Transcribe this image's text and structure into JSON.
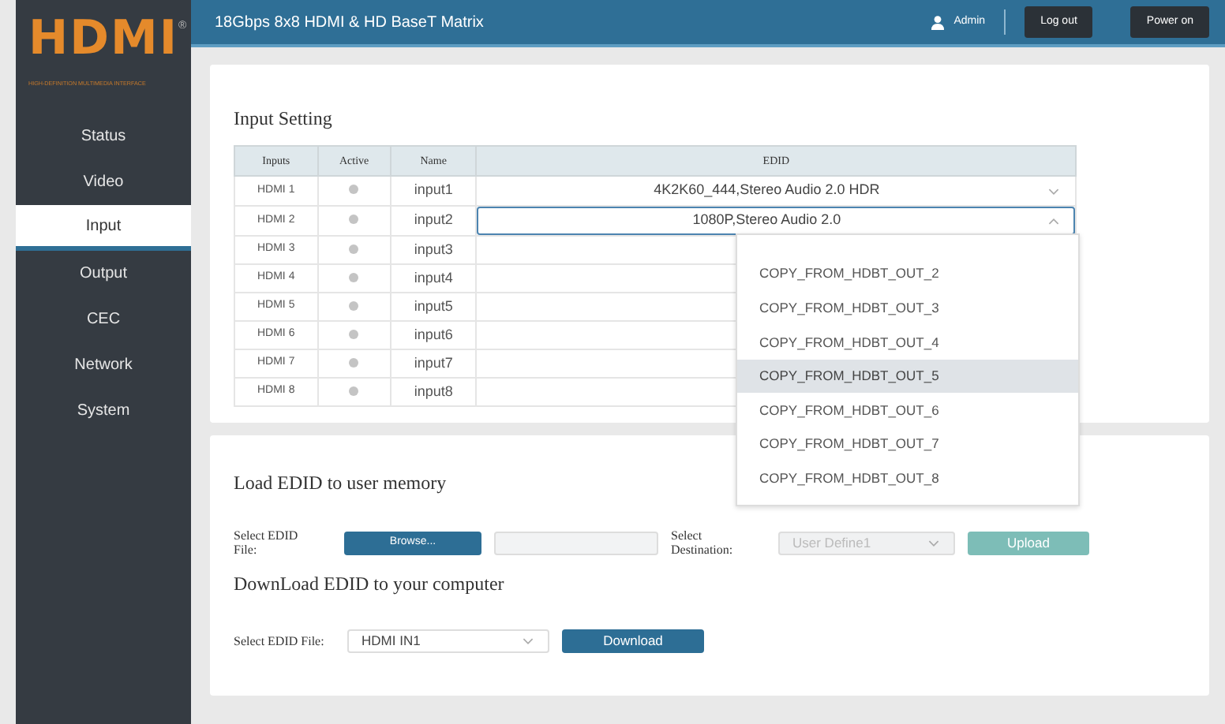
{
  "header": {
    "title": "18Gbps 8x8 HDMI & HD BaseT Matrix",
    "user": "Admin",
    "buttons": [
      "Log out",
      "Power on"
    ]
  },
  "logo": {
    "text": "HDMI",
    "mark": "®",
    "tagline": "HIGH-DEFINITION MULTIMEDIA INTERFACE"
  },
  "sidebar": {
    "items": [
      {
        "label": "Status",
        "selected": false
      },
      {
        "label": "Video",
        "selected": false
      },
      {
        "label": "Input",
        "selected": true
      },
      {
        "label": "Output",
        "selected": false
      },
      {
        "label": "CEC",
        "selected": false
      },
      {
        "label": "Network",
        "selected": false
      },
      {
        "label": "System",
        "selected": false
      }
    ]
  },
  "input_setting": {
    "title": "Input Setting",
    "columns": [
      "Inputs",
      "Active",
      "Name",
      "EDID"
    ],
    "rows": [
      {
        "input": "HDMI 1",
        "active": false,
        "name": "input1",
        "edid": "4K2K60_444,Stereo Audio 2.0 HDR",
        "open": false
      },
      {
        "input": "HDMI 2",
        "active": false,
        "name": "input2",
        "edid": "1080P,Stereo Audio 2.0",
        "open": true
      },
      {
        "input": "HDMI 3",
        "active": false,
        "name": "input3"
      },
      {
        "input": "HDMI 4",
        "active": false,
        "name": "input4"
      },
      {
        "input": "HDMI 5",
        "active": false,
        "name": "input5"
      },
      {
        "input": "HDMI 6",
        "active": false,
        "name": "input6"
      },
      {
        "input": "HDMI 7",
        "active": false,
        "name": "input7"
      },
      {
        "input": "HDMI 8",
        "active": false,
        "name": "input8"
      }
    ]
  },
  "edid_dropdown": {
    "items": [
      {
        "label": "COPY_FROM_HDBT_OUT_2",
        "highlighted": false
      },
      {
        "label": "COPY_FROM_HDBT_OUT_3",
        "highlighted": false
      },
      {
        "label": "COPY_FROM_HDBT_OUT_4",
        "highlighted": false
      },
      {
        "label": "COPY_FROM_HDBT_OUT_5",
        "highlighted": true
      },
      {
        "label": "COPY_FROM_HDBT_OUT_6",
        "highlighted": false
      },
      {
        "label": "COPY_FROM_HDBT_OUT_7",
        "highlighted": false
      },
      {
        "label": "COPY_FROM_HDBT_OUT_8",
        "highlighted": false
      }
    ]
  },
  "load_edid": {
    "title": "Load EDID to user memory",
    "file_label": "Select EDID File:",
    "browse": "Browse...",
    "destination_label": "Select Destination:",
    "destination": "User Define1",
    "destination_disabled": true,
    "upload": "Upload"
  },
  "download_edid": {
    "title": "DownLoad EDID to your computer",
    "file_label": "Select EDID File:",
    "file": "HDMI IN1",
    "download": "Download"
  }
}
